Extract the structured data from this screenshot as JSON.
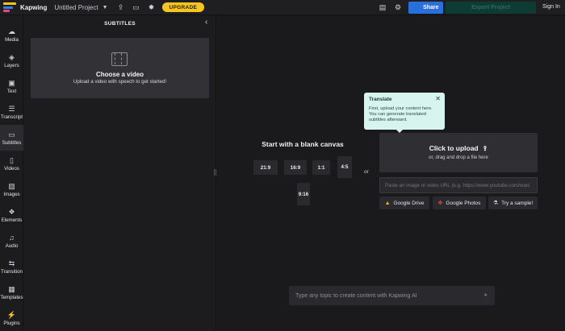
{
  "topbar": {
    "logo_text": "Kapwing",
    "logo_colors": [
      "#f5c518",
      "#2f80ed",
      "#e9467b"
    ],
    "project_title": "Untitled Project",
    "upgrade_label": "UPGRADE",
    "share_label": "Share",
    "export_label": "Export Project",
    "signin_label": "Sign In",
    "icons": [
      "upload-icon",
      "subtitles-box-icon",
      "bulb-icon",
      "chat-icon",
      "gear-icon"
    ]
  },
  "rail": {
    "items": [
      {
        "label": "Media",
        "icon": "media-icon"
      },
      {
        "label": "Layers",
        "icon": "layers-icon"
      },
      {
        "label": "Text",
        "icon": "text-icon"
      },
      {
        "label": "Transcript",
        "icon": "transcript-icon"
      },
      {
        "label": "Subtitles",
        "icon": "subtitles-icon",
        "active": true
      },
      {
        "label": "Videos",
        "icon": "videos-icon"
      },
      {
        "label": "Images",
        "icon": "images-icon"
      },
      {
        "label": "Elements",
        "icon": "elements-icon"
      },
      {
        "label": "Audio",
        "icon": "audio-icon"
      },
      {
        "label": "Transition",
        "icon": "transition-icon"
      },
      {
        "label": "Templates",
        "icon": "templates-icon"
      },
      {
        "label": "Plugins",
        "icon": "plugins-icon"
      }
    ]
  },
  "panel": {
    "title": "SUBTITLES",
    "choose_title": "Choose a video",
    "choose_sub": "Upload a video with speech to get started!"
  },
  "main": {
    "blank_title": "Start with a blank canvas",
    "ratios": [
      "21:9",
      "16:9",
      "1:1",
      "4:5",
      "9:16"
    ],
    "or_label": "or",
    "tooltip": {
      "title": "Translate",
      "body": "First, upload your content here. You can generate translated subtitles afterward."
    },
    "upload_title": "Click to upload",
    "upload_sub": "or, drag and drop a file here",
    "url_placeholder": "Paste an image or video URL (e.g. https://www.youtube.com/watc",
    "sources": [
      "Google Drive",
      "Google Photos",
      "Try a sample!"
    ],
    "ai_placeholder": "Type any topic to create content with Kapwing AI"
  }
}
